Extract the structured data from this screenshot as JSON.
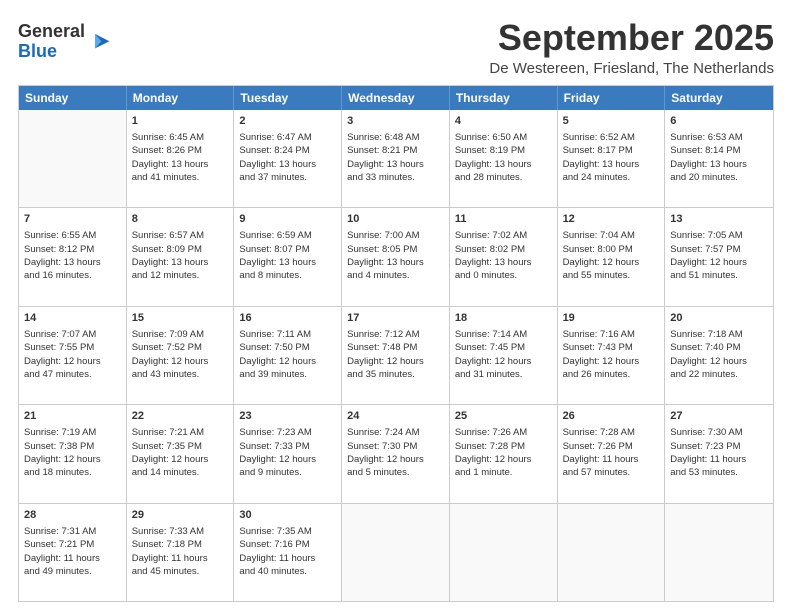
{
  "header": {
    "logo_general": "General",
    "logo_blue": "Blue",
    "month_title": "September 2025",
    "location": "De Westereen, Friesland, The Netherlands"
  },
  "days_of_week": [
    "Sunday",
    "Monday",
    "Tuesday",
    "Wednesday",
    "Thursday",
    "Friday",
    "Saturday"
  ],
  "rows": [
    [
      {
        "day": "",
        "lines": []
      },
      {
        "day": "1",
        "lines": [
          "Sunrise: 6:45 AM",
          "Sunset: 8:26 PM",
          "Daylight: 13 hours",
          "and 41 minutes."
        ]
      },
      {
        "day": "2",
        "lines": [
          "Sunrise: 6:47 AM",
          "Sunset: 8:24 PM",
          "Daylight: 13 hours",
          "and 37 minutes."
        ]
      },
      {
        "day": "3",
        "lines": [
          "Sunrise: 6:48 AM",
          "Sunset: 8:21 PM",
          "Daylight: 13 hours",
          "and 33 minutes."
        ]
      },
      {
        "day": "4",
        "lines": [
          "Sunrise: 6:50 AM",
          "Sunset: 8:19 PM",
          "Daylight: 13 hours",
          "and 28 minutes."
        ]
      },
      {
        "day": "5",
        "lines": [
          "Sunrise: 6:52 AM",
          "Sunset: 8:17 PM",
          "Daylight: 13 hours",
          "and 24 minutes."
        ]
      },
      {
        "day": "6",
        "lines": [
          "Sunrise: 6:53 AM",
          "Sunset: 8:14 PM",
          "Daylight: 13 hours",
          "and 20 minutes."
        ]
      }
    ],
    [
      {
        "day": "7",
        "lines": [
          "Sunrise: 6:55 AM",
          "Sunset: 8:12 PM",
          "Daylight: 13 hours",
          "and 16 minutes."
        ]
      },
      {
        "day": "8",
        "lines": [
          "Sunrise: 6:57 AM",
          "Sunset: 8:09 PM",
          "Daylight: 13 hours",
          "and 12 minutes."
        ]
      },
      {
        "day": "9",
        "lines": [
          "Sunrise: 6:59 AM",
          "Sunset: 8:07 PM",
          "Daylight: 13 hours",
          "and 8 minutes."
        ]
      },
      {
        "day": "10",
        "lines": [
          "Sunrise: 7:00 AM",
          "Sunset: 8:05 PM",
          "Daylight: 13 hours",
          "and 4 minutes."
        ]
      },
      {
        "day": "11",
        "lines": [
          "Sunrise: 7:02 AM",
          "Sunset: 8:02 PM",
          "Daylight: 13 hours",
          "and 0 minutes."
        ]
      },
      {
        "day": "12",
        "lines": [
          "Sunrise: 7:04 AM",
          "Sunset: 8:00 PM",
          "Daylight: 12 hours",
          "and 55 minutes."
        ]
      },
      {
        "day": "13",
        "lines": [
          "Sunrise: 7:05 AM",
          "Sunset: 7:57 PM",
          "Daylight: 12 hours",
          "and 51 minutes."
        ]
      }
    ],
    [
      {
        "day": "14",
        "lines": [
          "Sunrise: 7:07 AM",
          "Sunset: 7:55 PM",
          "Daylight: 12 hours",
          "and 47 minutes."
        ]
      },
      {
        "day": "15",
        "lines": [
          "Sunrise: 7:09 AM",
          "Sunset: 7:52 PM",
          "Daylight: 12 hours",
          "and 43 minutes."
        ]
      },
      {
        "day": "16",
        "lines": [
          "Sunrise: 7:11 AM",
          "Sunset: 7:50 PM",
          "Daylight: 12 hours",
          "and 39 minutes."
        ]
      },
      {
        "day": "17",
        "lines": [
          "Sunrise: 7:12 AM",
          "Sunset: 7:48 PM",
          "Daylight: 12 hours",
          "and 35 minutes."
        ]
      },
      {
        "day": "18",
        "lines": [
          "Sunrise: 7:14 AM",
          "Sunset: 7:45 PM",
          "Daylight: 12 hours",
          "and 31 minutes."
        ]
      },
      {
        "day": "19",
        "lines": [
          "Sunrise: 7:16 AM",
          "Sunset: 7:43 PM",
          "Daylight: 12 hours",
          "and 26 minutes."
        ]
      },
      {
        "day": "20",
        "lines": [
          "Sunrise: 7:18 AM",
          "Sunset: 7:40 PM",
          "Daylight: 12 hours",
          "and 22 minutes."
        ]
      }
    ],
    [
      {
        "day": "21",
        "lines": [
          "Sunrise: 7:19 AM",
          "Sunset: 7:38 PM",
          "Daylight: 12 hours",
          "and 18 minutes."
        ]
      },
      {
        "day": "22",
        "lines": [
          "Sunrise: 7:21 AM",
          "Sunset: 7:35 PM",
          "Daylight: 12 hours",
          "and 14 minutes."
        ]
      },
      {
        "day": "23",
        "lines": [
          "Sunrise: 7:23 AM",
          "Sunset: 7:33 PM",
          "Daylight: 12 hours",
          "and 9 minutes."
        ]
      },
      {
        "day": "24",
        "lines": [
          "Sunrise: 7:24 AM",
          "Sunset: 7:30 PM",
          "Daylight: 12 hours",
          "and 5 minutes."
        ]
      },
      {
        "day": "25",
        "lines": [
          "Sunrise: 7:26 AM",
          "Sunset: 7:28 PM",
          "Daylight: 12 hours",
          "and 1 minute."
        ]
      },
      {
        "day": "26",
        "lines": [
          "Sunrise: 7:28 AM",
          "Sunset: 7:26 PM",
          "Daylight: 11 hours",
          "and 57 minutes."
        ]
      },
      {
        "day": "27",
        "lines": [
          "Sunrise: 7:30 AM",
          "Sunset: 7:23 PM",
          "Daylight: 11 hours",
          "and 53 minutes."
        ]
      }
    ],
    [
      {
        "day": "28",
        "lines": [
          "Sunrise: 7:31 AM",
          "Sunset: 7:21 PM",
          "Daylight: 11 hours",
          "and 49 minutes."
        ]
      },
      {
        "day": "29",
        "lines": [
          "Sunrise: 7:33 AM",
          "Sunset: 7:18 PM",
          "Daylight: 11 hours",
          "and 45 minutes."
        ]
      },
      {
        "day": "30",
        "lines": [
          "Sunrise: 7:35 AM",
          "Sunset: 7:16 PM",
          "Daylight: 11 hours",
          "and 40 minutes."
        ]
      },
      {
        "day": "",
        "lines": []
      },
      {
        "day": "",
        "lines": []
      },
      {
        "day": "",
        "lines": []
      },
      {
        "day": "",
        "lines": []
      }
    ]
  ]
}
